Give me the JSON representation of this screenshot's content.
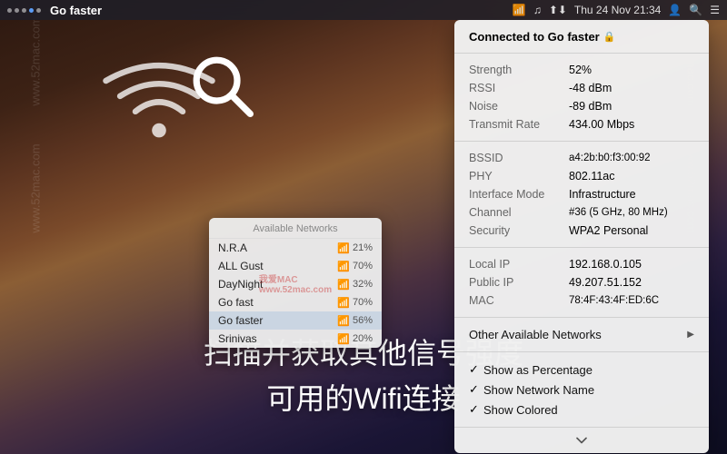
{
  "menubar": {
    "dots": [
      "dot",
      "dot",
      "dot active"
    ],
    "appname": "Go faster",
    "right_items": [
      "Thu 24 Nov  21:34",
      "👤",
      "🔍",
      "☰"
    ],
    "icons": [
      "wifi-icon",
      "music-icon",
      "network-icon",
      "battery-icon"
    ]
  },
  "desktop": {
    "watermark_lines": [
      "www.52mac.com",
      "www.52mac.com"
    ],
    "chinese_line1": "扫描并获取其他信号强度",
    "chinese_line2": "可用的Wifi连接"
  },
  "dropdown": {
    "connected_label": "Connected to Go faster",
    "lock": "🔒",
    "rows": [
      {
        "label": "Strength",
        "value": "52%"
      },
      {
        "label": "RSSI",
        "value": "-48 dBm"
      },
      {
        "label": "Noise",
        "value": "-89 dBm"
      },
      {
        "label": "Transmit Rate",
        "value": "434.00 Mbps"
      }
    ],
    "rows2": [
      {
        "label": "BSSID",
        "value": "a4:2b:b0:f3:00:92"
      },
      {
        "label": "PHY",
        "value": "802.11ac"
      },
      {
        "label": "Interface Mode",
        "value": "Infrastructure"
      },
      {
        "label": "Channel",
        "value": "#36 (5 GHz, 80 MHz)"
      },
      {
        "label": "Security",
        "value": "WPA2 Personal"
      }
    ],
    "rows3": [
      {
        "label": "Local IP",
        "value": "192.168.0.105"
      },
      {
        "label": "Public IP",
        "value": "49.207.51.152"
      },
      {
        "label": "MAC",
        "value": "78:4F:43:4F:ED:6C"
      }
    ],
    "other_networks": "Other Available Networks",
    "menu_items": [
      {
        "check": "✓",
        "label": "Show as Percentage"
      },
      {
        "check": "✓",
        "label": "Show Network Name"
      },
      {
        "check": "✓",
        "label": "Show Colored"
      }
    ]
  },
  "networks_panel": {
    "header": "Available Networks",
    "watermark": "我爱MAC\nwww.52mac.com",
    "networks": [
      {
        "name": "N.R.A",
        "signal": "📶",
        "pct": "21%"
      },
      {
        "name": "ALL Gust",
        "signal": "📶",
        "pct": "70%"
      },
      {
        "name": "DayNight",
        "signal": "📶",
        "pct": "32%"
      },
      {
        "name": "Go fast",
        "signal": "📶",
        "pct": "70%"
      },
      {
        "name": "Go faster",
        "signal": "📶",
        "pct": "56%"
      },
      {
        "name": "Srinivas",
        "signal": "📶",
        "pct": "20%"
      }
    ]
  }
}
